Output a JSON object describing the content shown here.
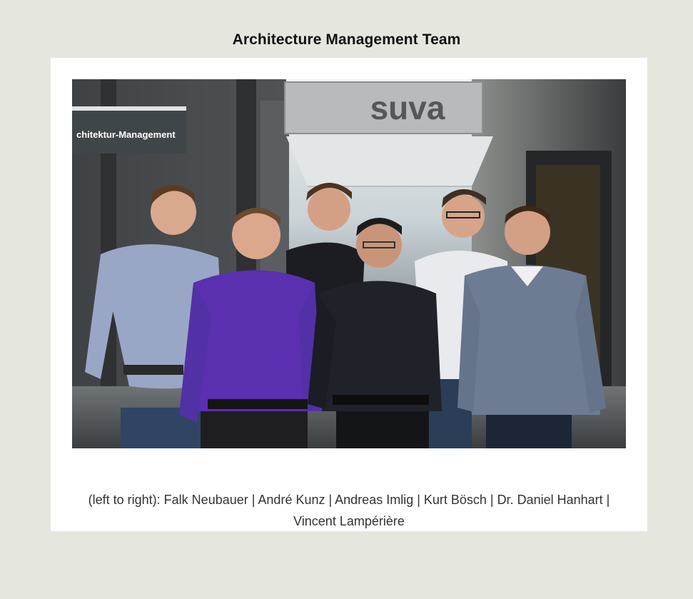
{
  "page": {
    "title": "Architecture Management Team"
  },
  "photo": {
    "suva_sign": "suva",
    "dept_sign": "chitektur-Management"
  },
  "caption": "(left to right): Falk Neubauer | André Kunz | Andreas Imlig | Kurt Bösch | Dr. Daniel Hanhart | Vincent Lampérière"
}
